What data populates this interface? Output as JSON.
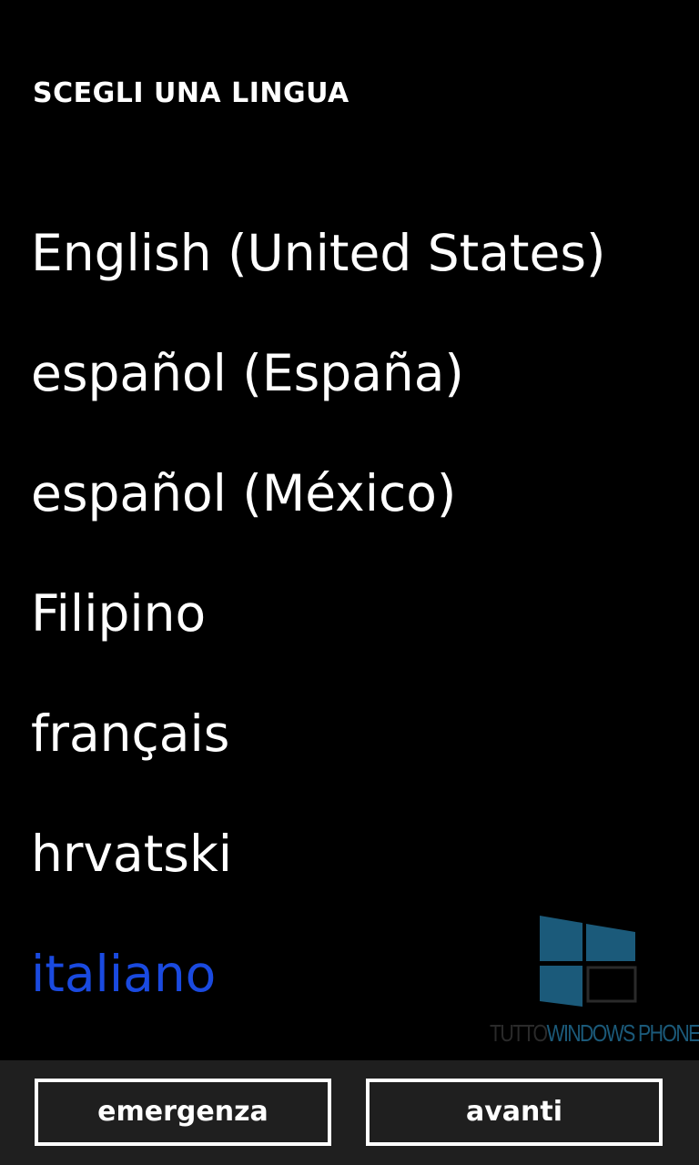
{
  "header": {
    "title": "SCEGLI UNA LINGUA"
  },
  "languages": {
    "items": [
      "English (United States)",
      "español (España)",
      "español (México)",
      "Filipino",
      "français",
      "hrvatski",
      "italiano"
    ],
    "selected": "italiano"
  },
  "watermark": {
    "text_part1": "TUTTO",
    "text_part2": "WINDOWS PHONE"
  },
  "app_bar": {
    "emergency_label": "emergenza",
    "next_label": "avanti"
  },
  "colors": {
    "background": "#000000",
    "text": "#ffffff",
    "accent": "#1a4ae0",
    "app_bar": "#1f1f1f",
    "watermark": "#1b5a7a"
  }
}
